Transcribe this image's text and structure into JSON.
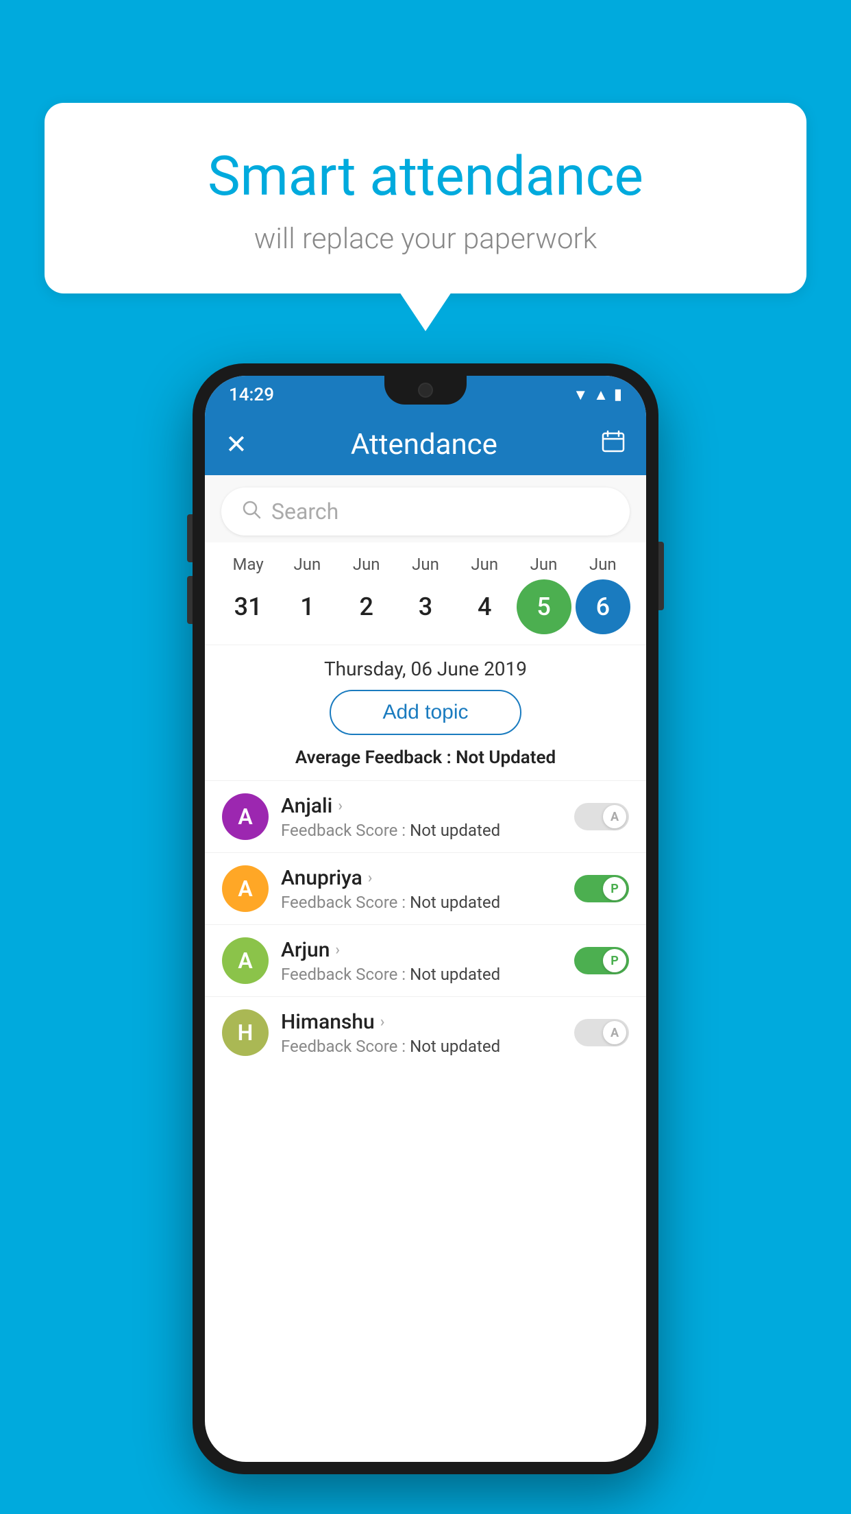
{
  "background_color": "#00AADD",
  "bubble": {
    "title": "Smart attendance",
    "subtitle": "will replace your paperwork"
  },
  "phone": {
    "status_bar": {
      "time": "14:29"
    },
    "app_bar": {
      "title": "Attendance",
      "close_icon": "✕",
      "calendar_icon": "📅"
    },
    "search": {
      "placeholder": "Search"
    },
    "calendar": {
      "months": [
        "May",
        "Jun",
        "Jun",
        "Jun",
        "Jun",
        "Jun",
        "Jun"
      ],
      "dates": [
        "31",
        "1",
        "2",
        "3",
        "4",
        "5",
        "6"
      ],
      "today_index": 5,
      "selected_index": 6
    },
    "selected_date": "Thursday, 06 June 2019",
    "add_topic_label": "Add topic",
    "avg_feedback_label": "Average Feedback :",
    "avg_feedback_value": "Not Updated",
    "students": [
      {
        "name": "Anjali",
        "avatar_letter": "A",
        "avatar_color": "#9c27b0",
        "feedback_label": "Feedback Score :",
        "feedback_value": "Not updated",
        "status": "absent"
      },
      {
        "name": "Anupriya",
        "avatar_letter": "A",
        "avatar_color": "#ffa726",
        "feedback_label": "Feedback Score :",
        "feedback_value": "Not updated",
        "status": "present"
      },
      {
        "name": "Arjun",
        "avatar_letter": "A",
        "avatar_color": "#8bc34a",
        "feedback_label": "Feedback Score :",
        "feedback_value": "Not updated",
        "status": "present"
      },
      {
        "name": "Himanshu",
        "avatar_letter": "H",
        "avatar_color": "#aab854",
        "feedback_label": "Feedback Score :",
        "feedback_value": "Not updated",
        "status": "absent"
      }
    ]
  }
}
